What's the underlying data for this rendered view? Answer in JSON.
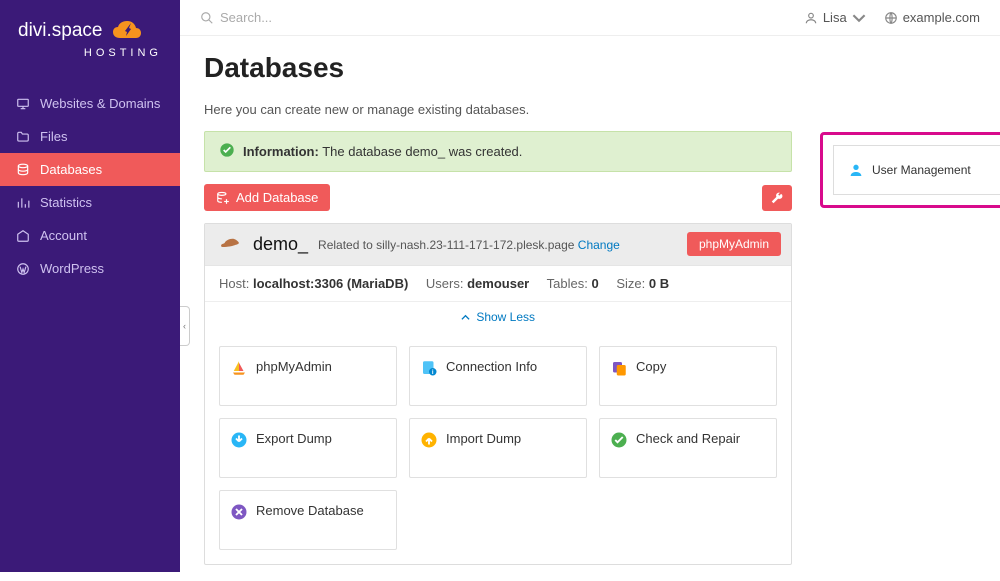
{
  "brand": {
    "top": "divi.space",
    "sub": "HOSTING"
  },
  "nav": [
    {
      "label": "Websites & Domains"
    },
    {
      "label": "Files"
    },
    {
      "label": "Databases"
    },
    {
      "label": "Statistics"
    },
    {
      "label": "Account"
    },
    {
      "label": "WordPress"
    }
  ],
  "topbar": {
    "search_placeholder": "Search...",
    "user": "Lisa",
    "domain": "example.com"
  },
  "page": {
    "title": "Databases",
    "intro": "Here you can create new or manage existing databases.",
    "info_label": "Information:",
    "info_text": "The database demo_ was created.",
    "add_btn": "Add Database",
    "phpmyadmin_btn": "phpMyAdmin",
    "show_less": "Show Less",
    "user_mgmt": "User Management"
  },
  "db": {
    "name": "demo_",
    "related_prefix": "Related to ",
    "related_site": "silly-nash.23-111-171-172.plesk.page",
    "change": "Change",
    "host_label": "Host:",
    "host": "localhost:3306 (MariaDB)",
    "users_label": "Users:",
    "users": "demouser",
    "tables_label": "Tables:",
    "tables": "0",
    "size_label": "Size:",
    "size": "0 B"
  },
  "tiles": [
    {
      "label": "phpMyAdmin"
    },
    {
      "label": "Connection Info"
    },
    {
      "label": "Copy"
    },
    {
      "label": "Export Dump"
    },
    {
      "label": "Import Dump"
    },
    {
      "label": "Check and Repair"
    },
    {
      "label": "Remove Database"
    }
  ]
}
